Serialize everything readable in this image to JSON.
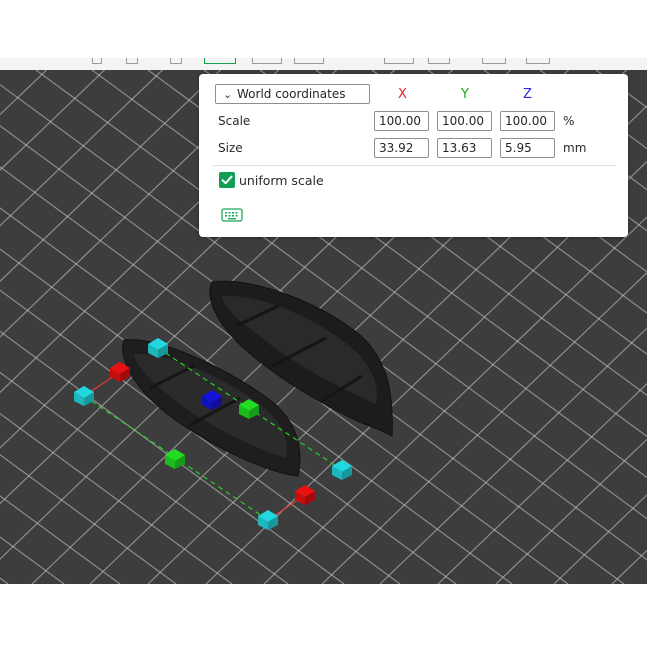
{
  "panel": {
    "coordinate_mode": "World coordinates",
    "axes": [
      {
        "label": "X",
        "color": "#e02424"
      },
      {
        "label": "Y",
        "color": "#1aa61a"
      },
      {
        "label": "Z",
        "color": "#2a2ad8"
      }
    ],
    "scale": {
      "label": "Scale",
      "x": "100.00",
      "y": "100.00",
      "z": "100.00",
      "unit": "%"
    },
    "size": {
      "label": "Size",
      "x": "33.92",
      "y": "13.63",
      "z": "5.95",
      "unit": "mm"
    },
    "uniform_scale": {
      "label": "uniform scale",
      "checked": true
    },
    "icons": {
      "dropdown": "chevron-down-icon",
      "checkbox": "checkmark-icon",
      "keyboard": "keyboard-icon"
    }
  },
  "viewport": {
    "background": "#3d3d3e",
    "grid_color": "#cfcfcf",
    "objects": [
      "boat model (selected)",
      "boat model"
    ],
    "handle_colors": {
      "x": "#e81010",
      "y": "#22dd22",
      "z": "#1414d8",
      "corner": "#22d8e0"
    }
  }
}
